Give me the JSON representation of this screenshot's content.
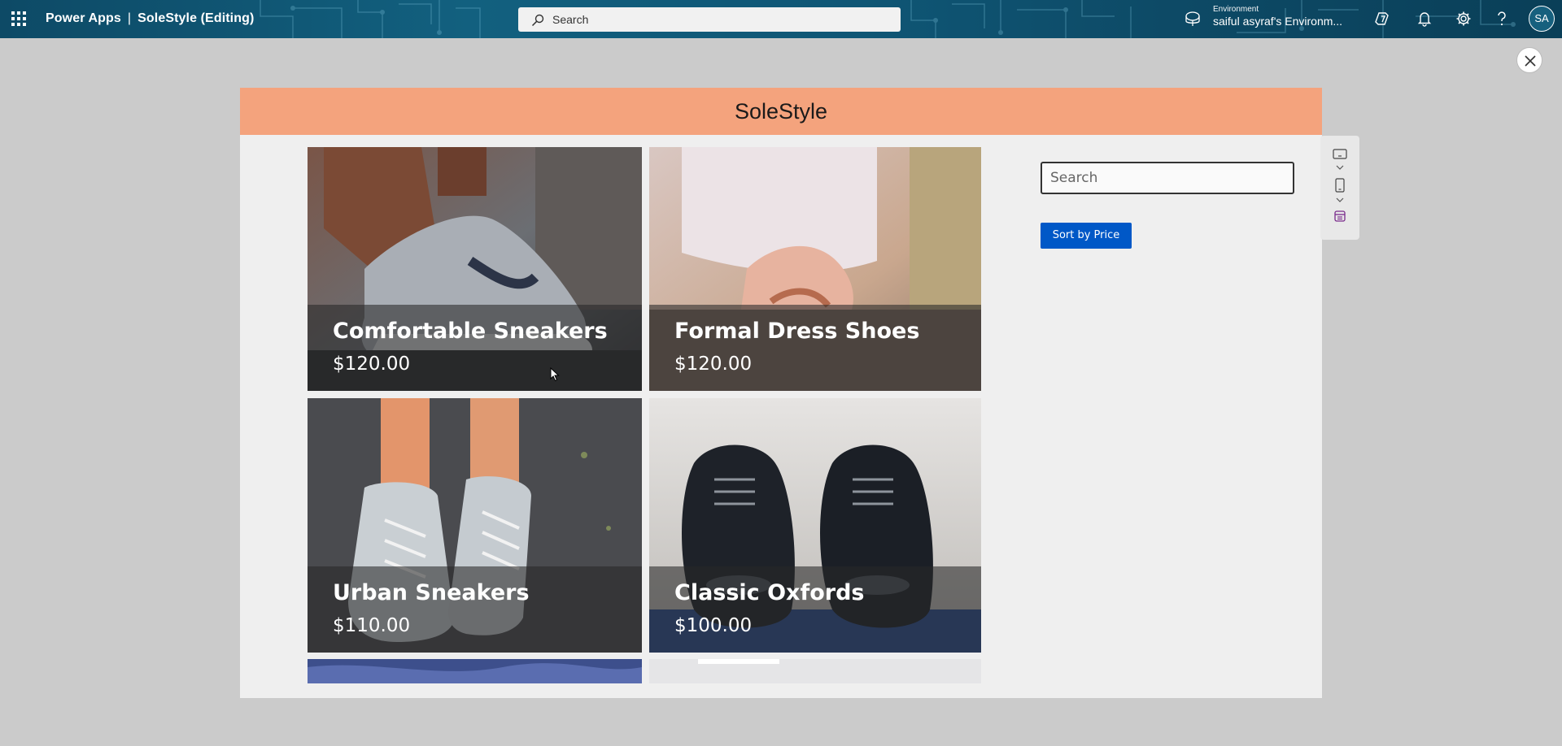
{
  "topbar": {
    "app_name": "Power Apps",
    "separator": "|",
    "doc_title": "SoleStyle (Editing)",
    "search_placeholder": "Search",
    "environment_label": "Environment",
    "environment_value": "saiful asyraf's Environm...",
    "avatar_initials": "SA",
    "icons": [
      "waffle-icon",
      "search-icon",
      "environment-icon",
      "copilot-icon",
      "bell-icon",
      "gear-icon",
      "help-icon"
    ]
  },
  "app": {
    "title": "SoleStyle",
    "search_placeholder": "Search",
    "sort_button": "Sort by Price",
    "header_color": "#f4a37d",
    "button_color": "#0058c7"
  },
  "products": [
    {
      "name": "Comfortable Sneakers",
      "price": "$120.00"
    },
    {
      "name": "Formal Dress Shoes",
      "price": "$120.00"
    },
    {
      "name": "Urban Sneakers",
      "price": "$110.00"
    },
    {
      "name": "Classic Oxfords",
      "price": "$100.00"
    }
  ]
}
